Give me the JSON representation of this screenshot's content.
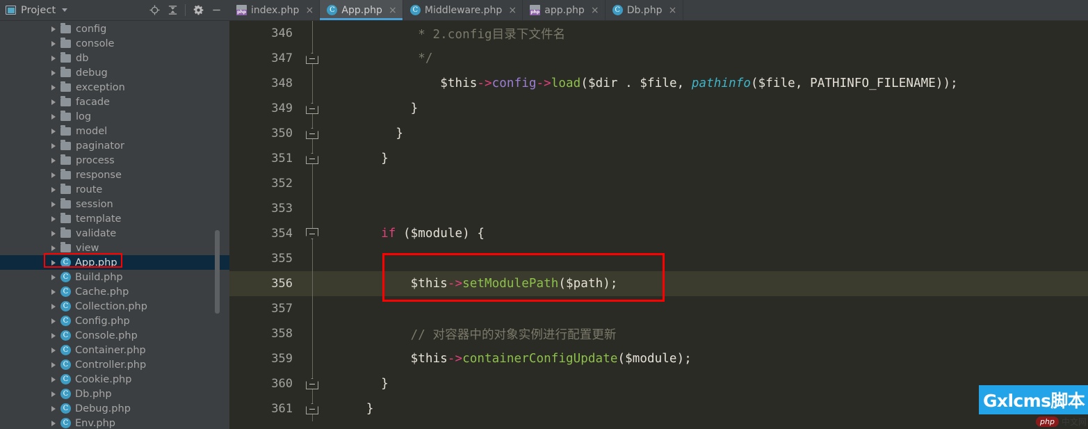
{
  "panel": {
    "title": "Project",
    "caret_icon": "chevron-down-icon",
    "window_icon": "project-window-icon",
    "tools": [
      {
        "name": "locate-target-icon",
        "label": ""
      },
      {
        "name": "collapse-all-icon",
        "label": ""
      },
      {
        "name": "gear-icon",
        "label": ""
      },
      {
        "name": "minimize-icon",
        "label": ""
      }
    ]
  },
  "tree": {
    "items": [
      {
        "label": "config",
        "type": "folder"
      },
      {
        "label": "console",
        "type": "folder"
      },
      {
        "label": "db",
        "type": "folder"
      },
      {
        "label": "debug",
        "type": "folder"
      },
      {
        "label": "exception",
        "type": "folder"
      },
      {
        "label": "facade",
        "type": "folder"
      },
      {
        "label": "log",
        "type": "folder"
      },
      {
        "label": "model",
        "type": "folder"
      },
      {
        "label": "paginator",
        "type": "folder"
      },
      {
        "label": "process",
        "type": "folder"
      },
      {
        "label": "response",
        "type": "folder"
      },
      {
        "label": "route",
        "type": "folder"
      },
      {
        "label": "session",
        "type": "folder"
      },
      {
        "label": "template",
        "type": "folder"
      },
      {
        "label": "validate",
        "type": "folder"
      },
      {
        "label": "view",
        "type": "folder"
      },
      {
        "label": "App.php",
        "type": "php",
        "selected": true
      },
      {
        "label": "Build.php",
        "type": "php"
      },
      {
        "label": "Cache.php",
        "type": "php"
      },
      {
        "label": "Collection.php",
        "type": "php"
      },
      {
        "label": "Config.php",
        "type": "php"
      },
      {
        "label": "Console.php",
        "type": "php"
      },
      {
        "label": "Container.php",
        "type": "php"
      },
      {
        "label": "Controller.php",
        "type": "php"
      },
      {
        "label": "Cookie.php",
        "type": "php"
      },
      {
        "label": "Db.php",
        "type": "php"
      },
      {
        "label": "Debug.php",
        "type": "php"
      },
      {
        "label": "Env.php",
        "type": "php"
      }
    ]
  },
  "tabs": [
    {
      "label": "index.php",
      "icon": "php-file-icon",
      "active": false,
      "close": "×"
    },
    {
      "label": "App.php",
      "icon": "php-class-icon",
      "active": true,
      "close": "×"
    },
    {
      "label": "Middleware.php",
      "icon": "php-class-icon",
      "active": false,
      "close": "×"
    },
    {
      "label": "app.php",
      "icon": "php-file-icon",
      "active": false,
      "close": "×"
    },
    {
      "label": "Db.php",
      "icon": "php-class-icon",
      "active": false,
      "close": "×"
    }
  ],
  "editor": {
    "lines": [
      {
        "number": "346",
        "fold": "none",
        "current": false,
        "tokens": [
          {
            "t": "             * 2.config目录下文件名",
            "c": "t-comment"
          }
        ]
      },
      {
        "number": "347",
        "fold": "up",
        "current": false,
        "tokens": [
          {
            "t": "             */",
            "c": "t-comment"
          }
        ]
      },
      {
        "number": "348",
        "fold": "none",
        "current": false,
        "tokens": [
          {
            "t": "                ",
            "c": "t-plain"
          },
          {
            "t": "$this",
            "c": "t-var"
          },
          {
            "t": "->",
            "c": "t-arrow"
          },
          {
            "t": "config",
            "c": "t-prop"
          },
          {
            "t": "->",
            "c": "t-arrow"
          },
          {
            "t": "load",
            "c": "t-fn"
          },
          {
            "t": "(",
            "c": "t-plain"
          },
          {
            "t": "$dir",
            "c": "t-var"
          },
          {
            "t": " . ",
            "c": "t-dot"
          },
          {
            "t": "$file",
            "c": "t-var"
          },
          {
            "t": ", ",
            "c": "t-plain"
          },
          {
            "t": "pathinfo",
            "c": "t-fnit"
          },
          {
            "t": "(",
            "c": "t-plain"
          },
          {
            "t": "$file",
            "c": "t-var"
          },
          {
            "t": ", ",
            "c": "t-plain"
          },
          {
            "t": "PATHINFO_FILENAME",
            "c": "t-const"
          },
          {
            "t": "));",
            "c": "t-plain"
          }
        ]
      },
      {
        "number": "349",
        "fold": "up",
        "current": false,
        "tokens": [
          {
            "t": "            }",
            "c": "t-plain"
          }
        ]
      },
      {
        "number": "350",
        "fold": "up",
        "current": false,
        "tokens": [
          {
            "t": "          }",
            "c": "t-plain"
          }
        ]
      },
      {
        "number": "351",
        "fold": "up",
        "current": false,
        "tokens": [
          {
            "t": "        }",
            "c": "t-plain"
          }
        ]
      },
      {
        "number": "352",
        "fold": "none",
        "current": false,
        "tokens": [
          {
            "t": "",
            "c": "t-plain"
          }
        ]
      },
      {
        "number": "353",
        "fold": "none",
        "current": false,
        "tokens": [
          {
            "t": "",
            "c": "t-plain"
          }
        ]
      },
      {
        "number": "354",
        "fold": "down",
        "current": false,
        "tokens": [
          {
            "t": "        ",
            "c": "t-plain"
          },
          {
            "t": "if",
            "c": "t-kw"
          },
          {
            "t": " (",
            "c": "t-plain"
          },
          {
            "t": "$module",
            "c": "t-var"
          },
          {
            "t": ") {",
            "c": "t-plain"
          }
        ]
      },
      {
        "number": "355",
        "fold": "none",
        "current": false,
        "tokens": [
          {
            "t": "",
            "c": "t-plain"
          }
        ]
      },
      {
        "number": "356",
        "fold": "none",
        "current": true,
        "tokens": [
          {
            "t": "            ",
            "c": "t-plain"
          },
          {
            "t": "$this",
            "c": "t-var"
          },
          {
            "t": "->",
            "c": "t-arrow"
          },
          {
            "t": "setModulePath",
            "c": "t-fn"
          },
          {
            "t": "(",
            "c": "t-plain"
          },
          {
            "t": "$path",
            "c": "t-var"
          },
          {
            "t": ");",
            "c": "t-plain"
          }
        ]
      },
      {
        "number": "357",
        "fold": "none",
        "current": false,
        "tokens": [
          {
            "t": "",
            "c": "t-plain"
          }
        ]
      },
      {
        "number": "358",
        "fold": "none",
        "current": false,
        "tokens": [
          {
            "t": "            // 对容器中的对象实例进行配置更新",
            "c": "t-comment"
          }
        ]
      },
      {
        "number": "359",
        "fold": "none",
        "current": false,
        "tokens": [
          {
            "t": "            ",
            "c": "t-plain"
          },
          {
            "t": "$this",
            "c": "t-var"
          },
          {
            "t": "->",
            "c": "t-arrow"
          },
          {
            "t": "containerConfigUpdate",
            "c": "t-fn"
          },
          {
            "t": "(",
            "c": "t-plain"
          },
          {
            "t": "$module",
            "c": "t-var"
          },
          {
            "t": ");",
            "c": "t-plain"
          }
        ]
      },
      {
        "number": "360",
        "fold": "up",
        "current": false,
        "tokens": [
          {
            "t": "        }",
            "c": "t-plain"
          }
        ]
      },
      {
        "number": "361",
        "fold": "up",
        "current": false,
        "tokens": [
          {
            "t": "      }",
            "c": "t-plain"
          }
        ]
      }
    ]
  },
  "annotations": {
    "sidebar_highlight_target": "App.php",
    "code_highlight_target": "$this->setModulePath($path);",
    "box_color": "#ff0000"
  },
  "watermark": {
    "brand": "Gxlcms脚本",
    "php_badge": "php",
    "site": "中文网",
    "brand_bg": "#23a3e8"
  }
}
